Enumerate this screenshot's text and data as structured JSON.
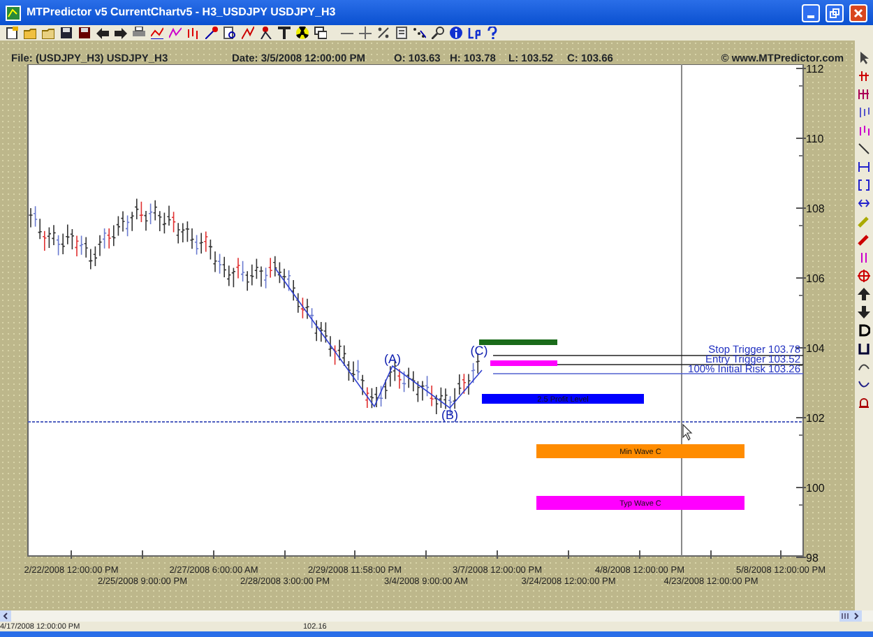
{
  "window": {
    "title": "MTPredictor v5 CurrentChartv5 - H3_USDJPY USDJPY_H3"
  },
  "header": {
    "file": "File: (USDJPY_H3) USDJPY_H3",
    "date": "Date: 3/5/2008 12:00:00 PM",
    "open": "O: 103.63",
    "high": "H: 103.78",
    "low": "L: 103.52",
    "close": "C: 103.66",
    "copyright": "© www.MTPredictor.com"
  },
  "y_axis": [
    "112",
    "110",
    "108",
    "106",
    "104",
    "102",
    "100",
    "98"
  ],
  "x_axis": {
    "row_1": [
      "2/22/2008 12:00:00 PM",
      "2/27/2008 6:00:00 AM",
      "2/29/2008 11:58:00 PM",
      "3/7/2008 12:00:00 PM",
      "4/8/2008 12:00:00 PM",
      "5/8/2008 12:00:00 PM"
    ],
    "row_2": [
      "2/25/2008 9:00:00 PM",
      "2/28/2008 3:00:00 PM",
      "3/4/2008 9:00:00 AM",
      "3/24/2008 12:00:00 PM",
      "4/23/2008 12:00:00 PM"
    ]
  },
  "wave_labels": [
    "(A)",
    "(B)",
    "(C)"
  ],
  "price_levels": [
    {
      "label": "Stop Trigger 103.78"
    },
    {
      "label": "Entry Trigger 103.52"
    },
    {
      "label": "100% Initial Risk 103.26"
    }
  ],
  "zones": [
    {
      "color": "#1a6b1a"
    },
    {
      "color": "#ff00ff"
    },
    {
      "label": "2.5 Profit Level",
      "color": "#0000ff"
    },
    {
      "label": "Min Wave C",
      "color": "#ff8c00"
    },
    {
      "label": "Typ Wave C",
      "color": "#ff00ff"
    }
  ],
  "status_bar": [
    "4/17/2008 12:00:00 PM",
    "102.16"
  ]
}
